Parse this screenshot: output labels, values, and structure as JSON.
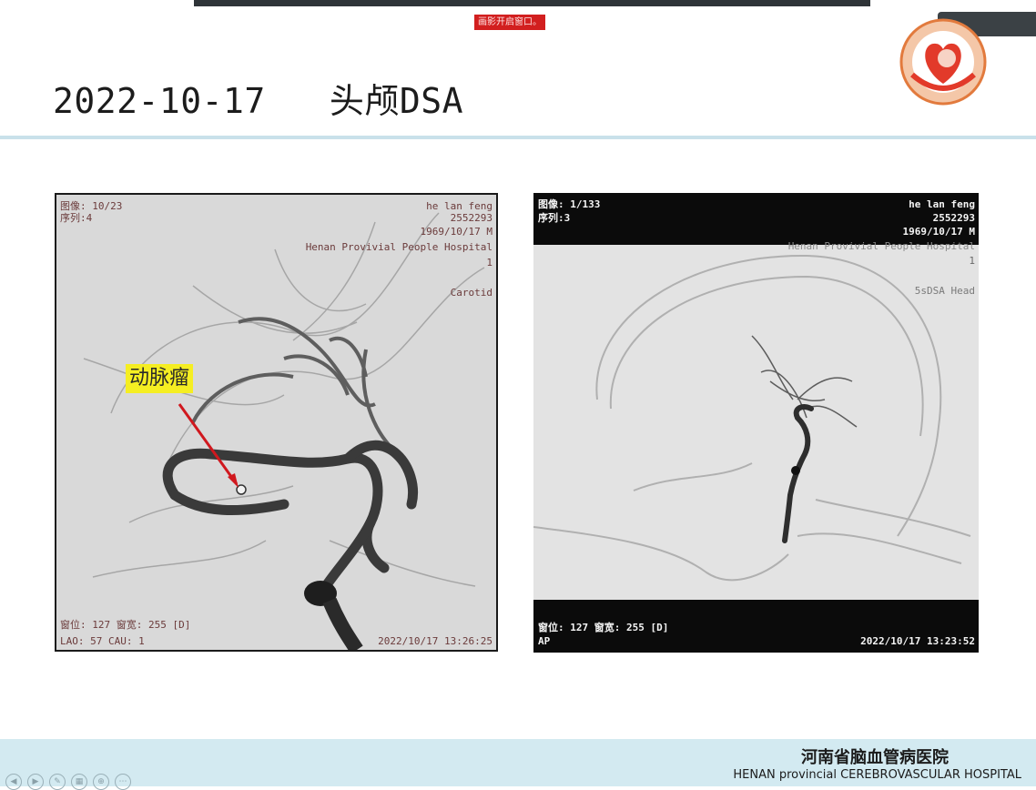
{
  "slide": {
    "title": "2022-10-17   头颅DSA",
    "share_notice": "画影开启窗口。"
  },
  "annotation": {
    "label": "动脉瘤"
  },
  "panel_left": {
    "image_info": "图像: 10/23",
    "series_info": "序列:4",
    "patient_name": "he lan feng",
    "patient_id": "2552293",
    "birth_sex": "1969/10/17 M",
    "hospital": "Henan Provivial People Hospital",
    "study_no": "1",
    "protocol": "Carotid",
    "window": "窗位: 127 窗宽: 255 [D]",
    "angle": "LAO: 57 CAU: 1",
    "timestamp": "2022/10/17 13:26:25"
  },
  "panel_right": {
    "image_info": "图像: 1/133",
    "series_info": "序列:3",
    "patient_name": "he lan feng",
    "patient_id": "2552293",
    "birth_sex": "1969/10/17 M",
    "hospital": "Henan Provivial People Hospital",
    "study_no": "1",
    "protocol": "5sDSA Head",
    "window": "窗位: 127 窗宽: 255 [D]",
    "view": "AP",
    "timestamp": "2022/10/17 13:23:52"
  },
  "footer": {
    "hospital_cn": "河南省脑血管病医院",
    "hospital_en": "HENAN provincial  CEREBROVASCULAR  HOSPITAL"
  },
  "colors": {
    "accent_line": "#c9e1ea",
    "footer_bg": "#d3eaf1",
    "arrow": "#d0181e",
    "highlight": "#f5ee22"
  }
}
